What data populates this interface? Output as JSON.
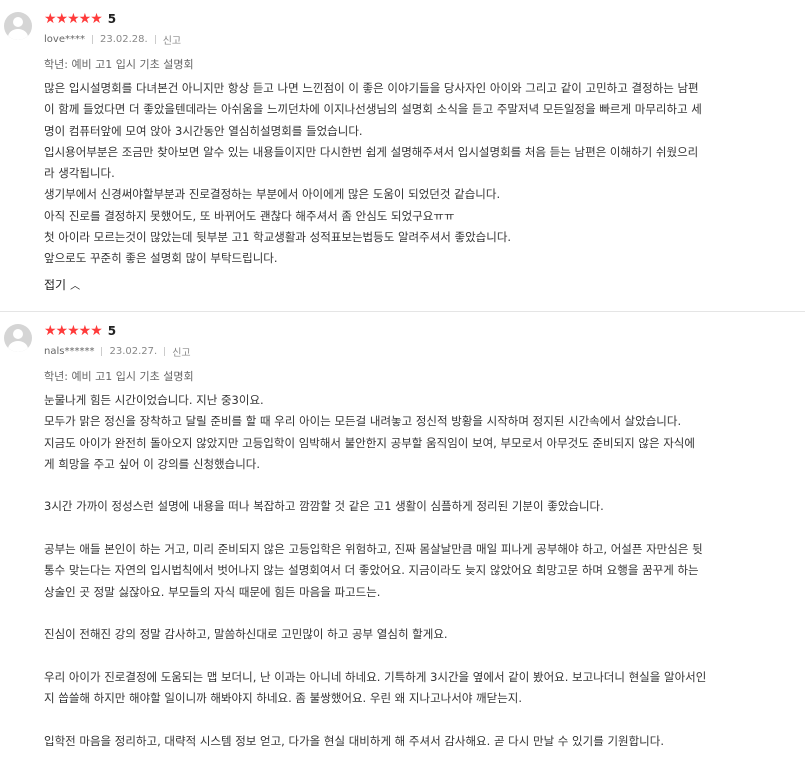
{
  "reviews": [
    {
      "stars": "★★★★★",
      "score": "5",
      "user": "love****",
      "date": "23.02.28.",
      "report": "신고",
      "course": "학년: 예비 고1 입시 기초 설명회",
      "lines": [
        "많은 입시설명회를 다녀본건 아니지만 항상 듣고 나면 느낀점이 이 좋은 이야기들을 당사자인 아이와 그리고 같이 고민하고 결정하는 남편",
        "이 함께 들었다면 더 좋았을텐데라는 아쉬움을 느끼던차에 이지나선생님의 설명회 소식을 듣고 주말저녁 모든일정을 빠르게 마무리하고 세",
        "명이 컴퓨터앞에 모여 앉아 3시간동안 열심히설명회를 들었습니다.",
        "입시용어부분은 조금만 찾아보면 알수 있는 내용들이지만 다시한번 쉽게 설명해주셔서 입시설명회를 처음 듣는 남편은 이해하기 쉬웠으리",
        "라 생각됩니다.",
        "생기부에서 신경써야할부분과 진로결정하는 부분에서 아이에게 많은 도움이 되었던것 같습니다.",
        "아직 진로를 결정하지 못했어도, 또 바뀌어도 괜찮다 해주셔서 좀 안심도 되었구요ㅠㅠ",
        "첫 아이라 모르는것이 많았는데 뒷부분 고1 학교생활과 성적표보는법등도 알려주셔서 좋았습니다.",
        "앞으로도 꾸준히 좋은 설명회 많이 부탁드립니다."
      ],
      "fold_label": "접기",
      "fold_icon": "chevron-up-icon"
    },
    {
      "stars": "★★★★★",
      "score": "5",
      "user": "nals******",
      "date": "23.02.27.",
      "report": "신고",
      "course": "학년: 예비 고1 입시 기초 설명회",
      "lines": [
        "눈물나게 힘든 시간이었습니다. 지난 중3이요.",
        "모두가 맑은 정신을 장착하고 달릴 준비를 할 때 우리 아이는 모든걸 내려놓고 정신적 방황을 시작하며 정지된 시간속에서 살았습니다.",
        "지금도 아이가 완전히 돌아오지 않았지만 고등입학이 임박해서 불안한지 공부할 움직임이 보여, 부모로서 아무것도 준비되지 않은 자식에",
        "게 희망을 주고 싶어 이 강의를 신청했습니다.",
        "",
        "3시간 가까이 정성스런 설명에 내용을 떠나 복잡하고 깜깜할 것 같은 고1 생활이 심플하게 정리된 기분이 좋았습니다.",
        "",
        "공부는 애들 본인이 하는 거고, 미리 준비되지 않은 고등입학은 위험하고, 진짜 몸살날만큼 매일 피나게 공부해야 하고, 어설픈 자만심은 뒷",
        "통수 맞는다는 자연의 입시법칙에서 벗어나지 않는 설명회여서 더 좋았어요. 지금이라도 늦지 않았어요 희망고문 하며 요행을 꿈꾸게 하는",
        "상술인 곳 정말 싫잖아요. 부모들의 자식 때문에 힘든 마음을 파고드는.",
        "",
        "진심이 전해진 강의 정말 감사하고, 말씀하신대로 고민많이 하고 공부 열심히 할게요.",
        "",
        "우리 아이가 진로결정에 도움되는 맵 보더니, 난 이과는 아니네 하네요. 기특하게 3시간을 옆에서 같이 봤어요. 보고나더니 현실을 알아서인",
        "지 씁쓸해 하지만 해야할 일이니까 해봐야지 하네요. 좀 불쌍했어요. 우린 왜 지나고나서야 깨닫는지.",
        "",
        "입학전 마음을 정리하고, 대략적 시스템 정보 얻고, 다가올 현실 대비하게 해 주셔서 감사해요. 곧 다시 만날 수 있기를 기원합니다."
      ]
    }
  ]
}
